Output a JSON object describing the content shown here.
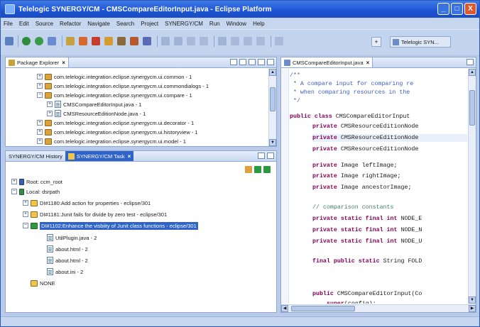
{
  "window": {
    "title": "Telelogic SYNERGY/CM - CMSCompareEditorInput.java - Eclipse Platform",
    "controls": [
      "_",
      "□",
      "X"
    ]
  },
  "menu": [
    "File",
    "Edit",
    "Source",
    "Refactor",
    "Navigate",
    "Search",
    "Project",
    "SYNERGY/CM",
    "Run",
    "Window",
    "Help"
  ],
  "perspective": {
    "label": "Telelogic SYN..."
  },
  "package_explorer": {
    "tab_label": "Package Explorer",
    "items": [
      {
        "label": "com.telelogic.integration.eclipse.synergycm.ui.common - 1",
        "kind": "package"
      },
      {
        "label": "com.telelogic.integration.eclipse.synergycm.ui.commondialogs - 1",
        "kind": "package"
      },
      {
        "label": "com.telelogic.integration.eclipse.synergycm.ui.compare - 1",
        "kind": "package"
      },
      {
        "label": "CMSCompareEditorInput.java - 1",
        "kind": "file"
      },
      {
        "label": "CMSResourceEditionNode.java - 1",
        "kind": "file"
      },
      {
        "label": "com.telelogic.integration.eclipse.synergycm.ui.decorator - 1",
        "kind": "package"
      },
      {
        "label": "com.telelogic.integration.eclipse.synergycm.ui.historyview - 1",
        "kind": "package"
      },
      {
        "label": "com.telelogic.integration.eclipse.synergycm.ui.model - 1",
        "kind": "package"
      }
    ]
  },
  "task_view": {
    "tabs": [
      {
        "label": "SYNERGY/CM History"
      },
      {
        "label": "SYNERGY/CM Task"
      }
    ],
    "items": [
      {
        "label": "Root: ccm_root",
        "kind": "root"
      },
      {
        "label": "Local: dsrpath",
        "kind": "root"
      },
      {
        "label": "DI#1180:Add action for properties - eclipse/301",
        "kind": "task"
      },
      {
        "label": "DI#1181:Junit fails for divide by zero test - eclipse/301",
        "kind": "task"
      },
      {
        "label": "DI#1102:Enhance the visbiity of  Junit class functions - eclipse/301",
        "kind": "task",
        "selected": true
      },
      {
        "label": "UtilPlugin.java - 2",
        "kind": "file"
      },
      {
        "label": "about.html - 2",
        "kind": "file"
      },
      {
        "label": "about.html - 2",
        "kind": "file"
      },
      {
        "label": "about.ini - 2",
        "kind": "file"
      },
      {
        "label": "NONE",
        "kind": "task"
      }
    ]
  },
  "editor": {
    "tab_label": "CMSCompareEditorInput.java",
    "lines": [
      {
        "kind": "comment",
        "text": "/**"
      },
      {
        "kind": "comment",
        "text": " * A compare input for comparing re"
      },
      {
        "kind": "comment",
        "text": " * when comparing resources in the "
      },
      {
        "kind": "comment",
        "text": " */"
      },
      {
        "kind": "code",
        "kw": "public class",
        "text": " CMSCompareEditorInput "
      },
      {
        "kind": "code",
        "kw": "private",
        "text": " CMSResourceEditionNode"
      },
      {
        "kind": "code",
        "kw": "private",
        "text": " CMSResourceEditionNode"
      },
      {
        "kind": "code",
        "kw": "private",
        "text": " CMSResourceEditionNode"
      },
      {
        "kind": "blank",
        "text": ""
      },
      {
        "kind": "code",
        "kw": "private",
        "text": " Image leftImage;"
      },
      {
        "kind": "code",
        "kw": "private",
        "text": " Image rightImage;"
      },
      {
        "kind": "code",
        "kw": "private",
        "text": " Image ancestorImage;"
      },
      {
        "kind": "blank",
        "text": ""
      },
      {
        "kind": "linecomment",
        "text": "// comparison constants"
      },
      {
        "kind": "code",
        "kw": "private static final int",
        "text": " NODE_E"
      },
      {
        "kind": "code",
        "kw": "private static final int",
        "text": " NODE_N"
      },
      {
        "kind": "code",
        "kw": "private static final int",
        "text": " NODE_U"
      },
      {
        "kind": "blank",
        "text": ""
      },
      {
        "kind": "code",
        "kw": "final public static",
        "text": " String FOLD"
      },
      {
        "kind": "blank",
        "text": ""
      },
      {
        "kind": "blank",
        "text": ""
      },
      {
        "kind": "code",
        "kw": "public",
        "text": " CMSCompareEditorInput(Co"
      },
      {
        "kind": "code",
        "kw": "super",
        "text": "(config);"
      }
    ]
  }
}
